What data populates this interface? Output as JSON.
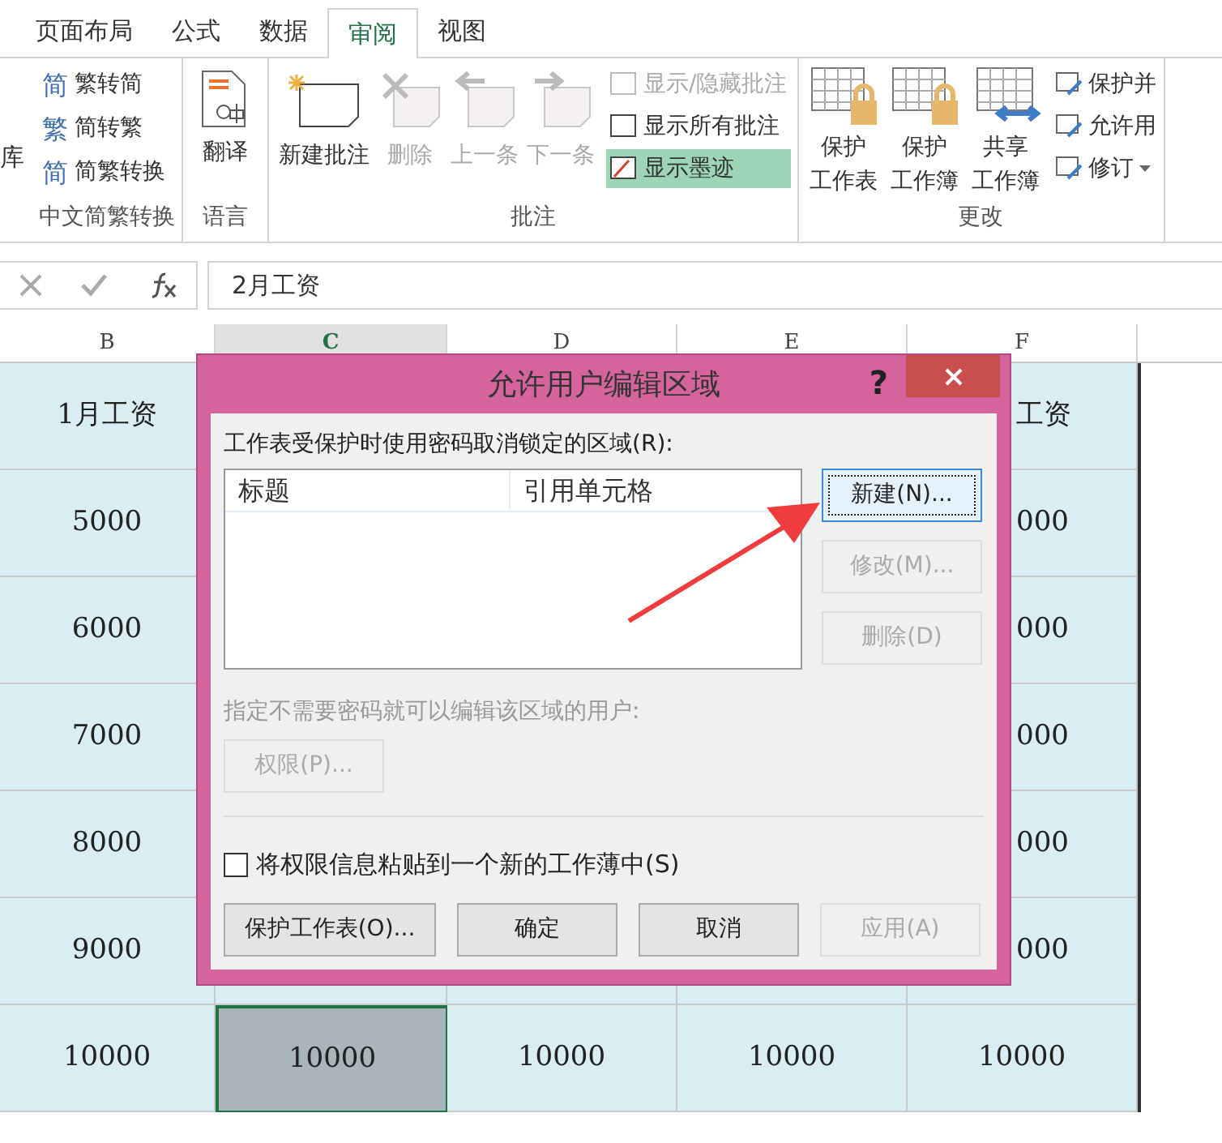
{
  "ribbon": {
    "cut_left": "库",
    "tabs": [
      {
        "label": "页面布局",
        "selected": false
      },
      {
        "label": "公式",
        "selected": false
      },
      {
        "label": "数据",
        "selected": false
      },
      {
        "label": "审阅",
        "selected": true
      },
      {
        "label": "视图",
        "selected": false
      }
    ],
    "groups": [
      {
        "label": "中文简繁转换",
        "kind": "list",
        "items": [
          {
            "label": "繁转简",
            "glyph": "简",
            "disabled": false,
            "selected": false
          },
          {
            "label": "简转繁",
            "glyph": "繁",
            "disabled": false,
            "selected": false
          },
          {
            "label": "简繁转换",
            "glyph": "简",
            "disabled": false,
            "selected": false
          }
        ]
      },
      {
        "label": "语言",
        "kind": "large",
        "items": [
          {
            "label": "翻译",
            "disabled": false
          }
        ]
      },
      {
        "label": "批注",
        "kind": "comments",
        "items": [
          {
            "label": "新建批注",
            "disabled": false
          },
          {
            "label": "删除",
            "disabled": true
          },
          {
            "label": "上一条",
            "disabled": true
          },
          {
            "label": "下一条",
            "disabled": true
          }
        ],
        "small": [
          {
            "label": "显示/隐藏批注",
            "disabled": true,
            "selected": false
          },
          {
            "label": "显示所有批注",
            "disabled": false,
            "selected": false
          },
          {
            "label": "显示墨迹",
            "disabled": false,
            "selected": true
          }
        ]
      },
      {
        "label": "更改",
        "kind": "changes",
        "items": [
          {
            "lines": [
              "保护",
              "工作表"
            ]
          },
          {
            "lines": [
              "保护",
              "工作簿"
            ]
          },
          {
            "lines": [
              "共享",
              "工作簿"
            ]
          }
        ],
        "small": [
          {
            "label": "保护并",
            "dropdown": false
          },
          {
            "label": "允许用",
            "dropdown": false
          },
          {
            "label": "修订",
            "dropdown": true
          }
        ]
      }
    ]
  },
  "formula_bar": {
    "value": "2月工资"
  },
  "sheet": {
    "columns": [
      {
        "label": "B",
        "selected": false
      },
      {
        "label": "C",
        "selected": true
      },
      {
        "label": "D",
        "selected": false
      },
      {
        "label": "E",
        "selected": false
      },
      {
        "label": "F",
        "selected": false
      }
    ],
    "rows": [
      [
        {
          "text": "1月工资",
          "selected": false
        },
        null,
        null,
        null,
        {
          "text": "工资",
          "selected": false
        }
      ],
      [
        {
          "text": "5000",
          "selected": false
        },
        null,
        null,
        null,
        {
          "text": "000",
          "selected": false
        }
      ],
      [
        {
          "text": "6000",
          "selected": false
        },
        null,
        null,
        null,
        {
          "text": "000",
          "selected": false
        }
      ],
      [
        {
          "text": "7000",
          "selected": false
        },
        null,
        null,
        null,
        {
          "text": "000",
          "selected": false
        }
      ],
      [
        {
          "text": "8000",
          "selected": false
        },
        null,
        null,
        null,
        {
          "text": "000",
          "selected": false
        }
      ],
      [
        {
          "text": "9000",
          "selected": false
        },
        null,
        null,
        null,
        {
          "text": "000",
          "selected": false
        }
      ],
      [
        {
          "text": "10000",
          "selected": false
        },
        {
          "text": "10000",
          "selected": true
        },
        {
          "text": "10000",
          "selected": false
        },
        {
          "text": "10000",
          "selected": false
        },
        {
          "text": "10000",
          "selected": false
        }
      ]
    ]
  },
  "dialog": {
    "title": "允许用户编辑区域",
    "help": "?",
    "ranges_label": "工作表受保护时使用密码取消锁定的区域(R):",
    "list_columns": [
      "标题",
      "引用单元格"
    ],
    "side_buttons": [
      {
        "label": "新建(N)...",
        "disabled": false,
        "focused": true
      },
      {
        "label": "修改(M)...",
        "disabled": true,
        "focused": false
      },
      {
        "label": "删除(D)",
        "disabled": true,
        "focused": false
      }
    ],
    "users_label": "指定不需要密码就可以编辑该区域的用户:",
    "users_disabled": true,
    "permissions_button": {
      "label": "权限(P)...",
      "disabled": true
    },
    "paste_checkbox": {
      "label": "将权限信息粘贴到一个新的工作薄中(S)",
      "checked": false
    },
    "buttons": [
      {
        "label": "保护工作表(O)...",
        "disabled": false
      },
      {
        "label": "确定",
        "disabled": false
      },
      {
        "label": "取消",
        "disabled": false
      },
      {
        "label": "应用(A)",
        "disabled": true
      }
    ]
  }
}
